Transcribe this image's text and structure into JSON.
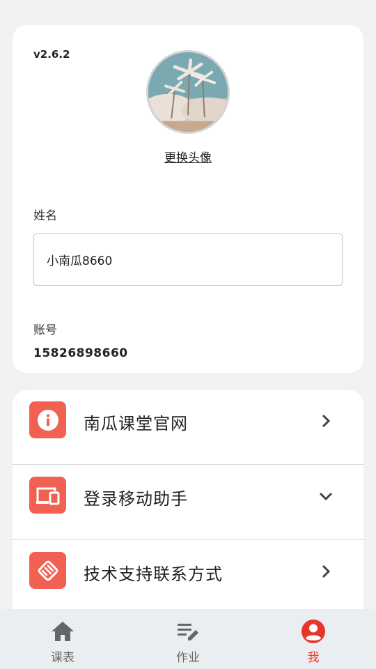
{
  "profile": {
    "version": "v2.6.2",
    "change_avatar": "更换头像",
    "name_label": "姓名",
    "name_value": "小南瓜8660",
    "account_label": "账号",
    "account_value": "15826898660"
  },
  "menu": {
    "items": [
      {
        "label": "南瓜课堂官网",
        "icon": "info-icon",
        "chevron": "chevron-right-icon"
      },
      {
        "label": "登录移动助手",
        "icon": "devices-icon",
        "chevron": "chevron-down-icon"
      },
      {
        "label": "技术支持联系方式",
        "icon": "handshake-icon",
        "chevron": "chevron-right-icon"
      }
    ],
    "accent_color": "#f26052"
  },
  "tabbar": {
    "tabs": [
      {
        "label": "课表",
        "icon": "home-icon",
        "active": false
      },
      {
        "label": "作业",
        "icon": "edit-list-icon",
        "active": false
      },
      {
        "label": "我",
        "icon": "account-icon",
        "active": true
      }
    ],
    "active_color": "#e8362a",
    "inactive_color": "#666666"
  }
}
